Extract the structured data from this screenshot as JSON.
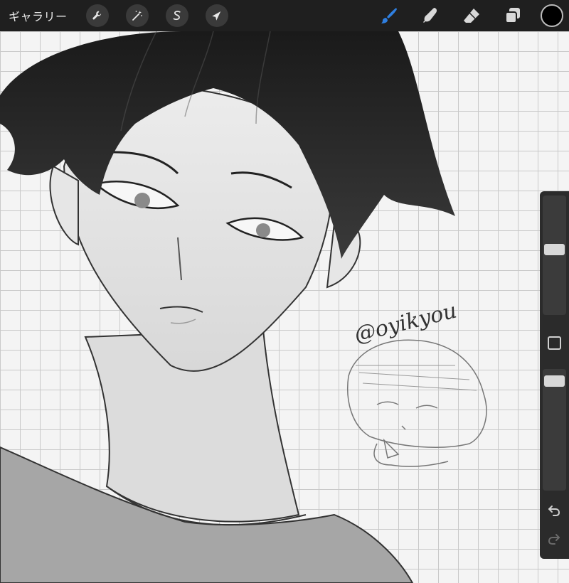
{
  "toolbar": {
    "gallery_label": "ギャラリー",
    "left_tools": [
      {
        "name": "actions",
        "icon": "wrench-icon"
      },
      {
        "name": "adjustments",
        "icon": "magic-wand-icon"
      },
      {
        "name": "selection",
        "icon": "selection-s-icon"
      },
      {
        "name": "transform",
        "icon": "arrow-cursor-icon"
      }
    ],
    "right_tools": [
      {
        "name": "brush",
        "icon": "brush-icon",
        "active": true
      },
      {
        "name": "smudge",
        "icon": "smudge-finger-icon",
        "active": false
      },
      {
        "name": "eraser",
        "icon": "eraser-icon",
        "active": false
      },
      {
        "name": "layers",
        "icon": "layers-icon",
        "active": false
      }
    ],
    "current_color": "#000000",
    "accent_color": "#2f7fe0"
  },
  "sidebar": {
    "brush_size_level": 0.55,
    "opacity_level": 0.94,
    "modify_icon": "square-modify-icon",
    "undo_icon": "undo-icon",
    "redo_icon": "redo-icon"
  },
  "canvas": {
    "signature_text": "@oyikyou"
  }
}
